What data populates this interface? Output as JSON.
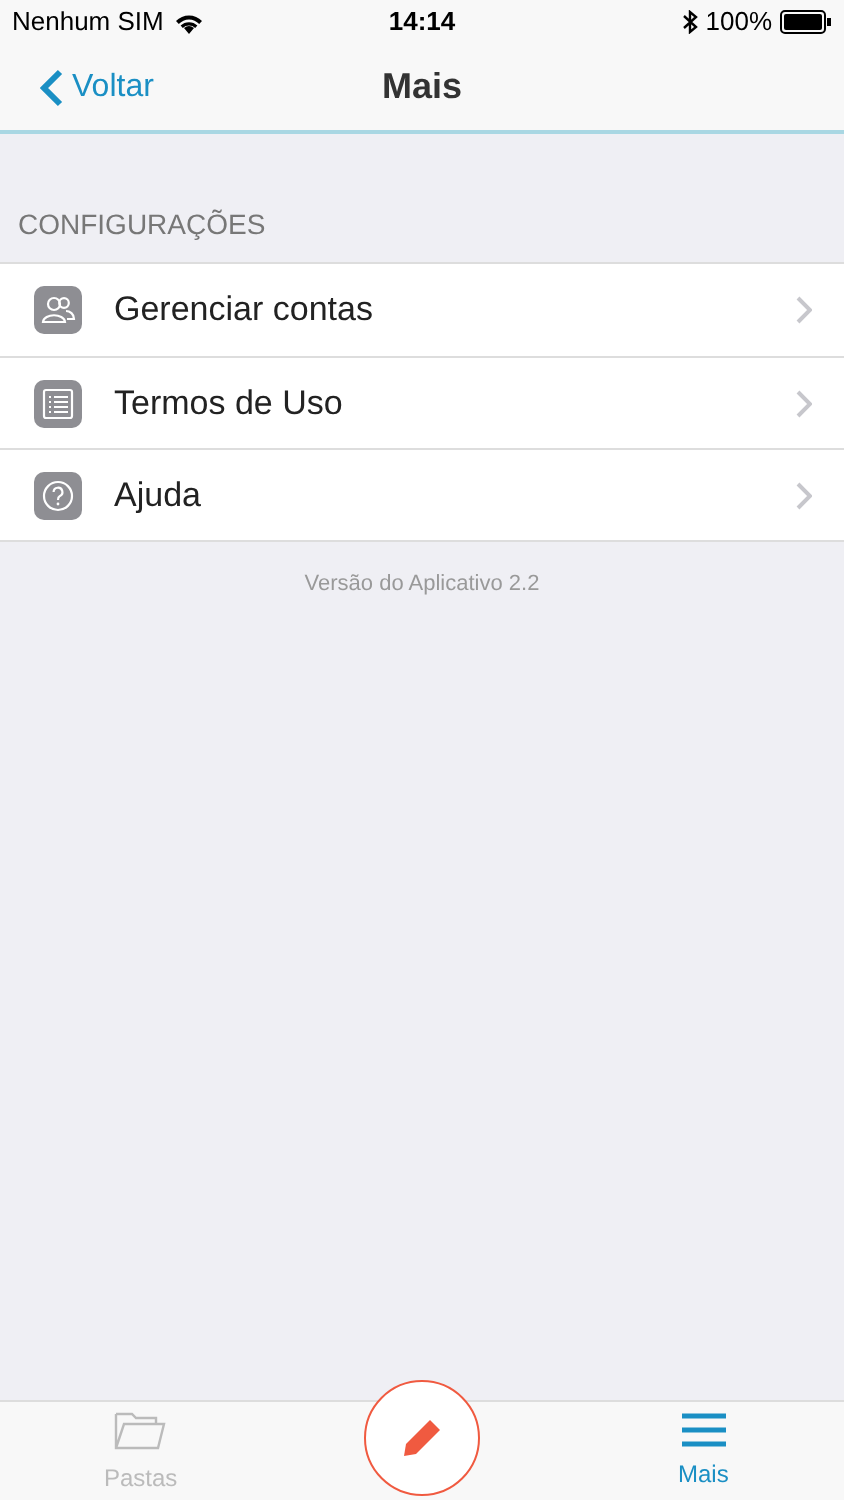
{
  "status_bar": {
    "carrier": "Nenhum SIM",
    "time": "14:14",
    "battery": "100%"
  },
  "nav": {
    "back": "Voltar",
    "title": "Mais"
  },
  "section": {
    "header": "CONFIGURAÇÕES",
    "items": [
      {
        "kind": "accounts",
        "label": "Gerenciar contas"
      },
      {
        "kind": "terms",
        "label": "Termos de Uso"
      },
      {
        "kind": "help",
        "label": "Ajuda"
      }
    ]
  },
  "version": "Versão do Aplicativo 2.2",
  "tab_bar": [
    {
      "kind": "folders",
      "label": "Pastas",
      "selected": false
    },
    {
      "kind": "compose",
      "selected": false
    },
    {
      "kind": "more",
      "label": "Mais",
      "selected": true
    }
  ]
}
